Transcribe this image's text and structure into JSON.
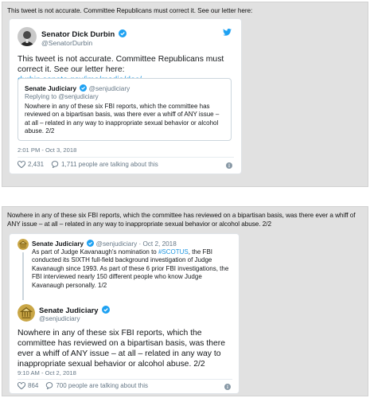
{
  "panel1": {
    "caption": "This tweet is not accurate. Committee Republicans must correct it. See our letter here:",
    "tweet": {
      "name": "Senator Dick Durbin",
      "handle": "@SenatorDurbin",
      "text": "This tweet is not accurate. Committee Republicans must correct it. See our letter here: ",
      "link": "durbin.senate.gov/imo/media/doc/…",
      "timestamp": "2:01 PM - Oct 3, 2018",
      "likes": "2,431",
      "talking": "1,711 people are talking about this",
      "quoted": {
        "name": "Senate Judiciary",
        "handle": "@senjudiciary",
        "replying": "Replying to @senjudiciary",
        "text": "Nowhere in any of these six FBI reports, which the committee has reviewed on a bipartisan basis, was there ever a whiff of ANY issue – at all – related in any way to inappropriate sexual behavior or alcohol abuse. 2/2"
      }
    }
  },
  "panel2": {
    "caption": "Nowhere in any of these six FBI reports, which the committee has reviewed on a bipartisan basis, was there ever a whiff of ANY issue – at all – related in any way to inappropriate sexual behavior or alcohol abuse. 2/2",
    "parent": {
      "name": "Senate Judiciary",
      "handle": "@senjudiciary · Oct 2, 2018",
      "text_a": "As part of Judge Kavanaugh's nomination to ",
      "hashtag": "#SCOTUS",
      "text_b": ", the FBI conducted its SIXTH full-field background investigation of Judge Kavanaugh since 1993. As part of these 6 prior FBI investigations, the FBI interviewed nearly 150 different people who know Judge Kavanaugh personally. 1/2"
    },
    "tweet": {
      "name": "Senate Judiciary",
      "handle": "@senjudiciary",
      "text": "Nowhere in any of these six FBI reports, which the committee has reviewed on a bipartisan basis, was there ever a whiff of ANY issue – at all – related in any way to inappropriate sexual behavior or alcohol abuse. 2/2",
      "timestamp": "9:10 AM - Oct 2, 2018",
      "likes": "864",
      "talking": "700 people are talking about this"
    }
  },
  "colors": {
    "link": "#1b95e0",
    "muted": "#657786",
    "text": "#14171a",
    "panel_bg": "#e1e1e1",
    "verified": "#1da1f2"
  },
  "icons": [
    "twitter-bird-icon",
    "verified-badge-icon",
    "heart-icon",
    "comment-bubble-icon",
    "info-icon"
  ]
}
